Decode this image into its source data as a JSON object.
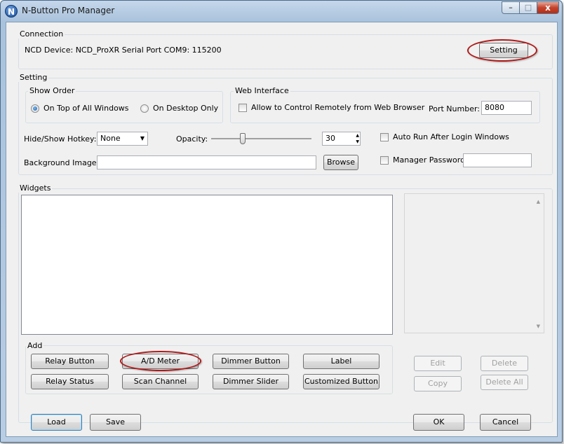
{
  "window": {
    "title": "N-Button Pro Manager",
    "icon_letter": "N",
    "min_glyph": "–",
    "max_glyph": "□",
    "close_glyph": "x"
  },
  "connection": {
    "label": "Connection",
    "status_text": "NCD Device: NCD_ProXR  Serial Port  COM9: 115200",
    "setting_button": "Setting"
  },
  "setting": {
    "label": "Setting",
    "show_order": {
      "label": "Show Order",
      "option_top": "On Top of All Windows",
      "option_desktop": "On Desktop Only",
      "selected": "top"
    },
    "web_interface": {
      "label": "Web Interface",
      "allow_remote_label": "Allow to Control Remotely from Web Browser",
      "port_label": "Port Number:",
      "port_value": "8080"
    },
    "hotkey_label": "Hide/Show Hotkey:",
    "hotkey_value": "None",
    "opacity_label": "Opacity:",
    "opacity_value": "30",
    "opacity_level_percent": 30,
    "auto_run_label": "Auto Run After Login Windows",
    "background_label": "Background Image:",
    "background_value": "",
    "browse_button": "Browse",
    "manager_password_label": "Manager Password",
    "manager_password_value": ""
  },
  "widgets": {
    "label": "Widgets",
    "edit_button": "Edit",
    "delete_button": "Delete",
    "copy_button": "Copy",
    "delete_all_button": "Delete All"
  },
  "add": {
    "label": "Add",
    "relay_button": "Relay Button",
    "ad_meter": "A/D Meter",
    "dimmer_button": "Dimmer Button",
    "label_button": "Label",
    "relay_status": "Relay Status",
    "scan_channel": "Scan Channel",
    "dimmer_slider": "Dimmer Slider",
    "customized_button": "Customized Button"
  },
  "footer": {
    "load": "Load",
    "save": "Save",
    "ok": "OK",
    "cancel": "Cancel"
  },
  "colors": {
    "highlight_ellipse": "#b01818",
    "close_button": "#c4422c",
    "titlebar": "#b9cde3"
  }
}
